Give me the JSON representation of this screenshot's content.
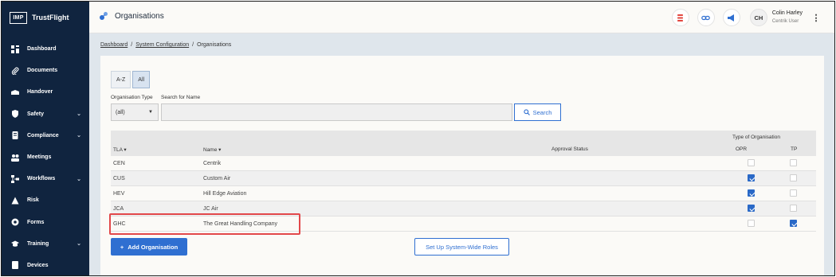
{
  "brand": {
    "logo_text": "IMP",
    "name": "TrustFlight"
  },
  "sidebar": {
    "items": [
      {
        "label": "Dashboard",
        "icon": "dashboard-icon",
        "has_chevron": false
      },
      {
        "label": "Documents",
        "icon": "paperclip-icon",
        "has_chevron": false
      },
      {
        "label": "Handover",
        "icon": "handover-icon",
        "has_chevron": false
      },
      {
        "label": "Safety",
        "icon": "shield-icon",
        "has_chevron": true
      },
      {
        "label": "Compliance",
        "icon": "compliance-icon",
        "has_chevron": true
      },
      {
        "label": "Meetings",
        "icon": "meetings-icon",
        "has_chevron": false
      },
      {
        "label": "Workflows",
        "icon": "workflows-icon",
        "has_chevron": true
      },
      {
        "label": "Risk",
        "icon": "risk-icon",
        "has_chevron": false
      },
      {
        "label": "Forms",
        "icon": "forms-icon",
        "has_chevron": false
      },
      {
        "label": "Training",
        "icon": "graduation-cap-icon",
        "has_chevron": true
      },
      {
        "label": "Devices",
        "icon": "devices-icon",
        "has_chevron": false
      }
    ],
    "chevron": "⌄"
  },
  "header": {
    "title": "Organisations",
    "user": {
      "initials": "CH",
      "name": "Colin Harley",
      "role": "Centrik User"
    }
  },
  "breadcrumb": {
    "items": [
      "Dashboard",
      "System Configuration",
      "Organisations"
    ],
    "separator": "/"
  },
  "filters": {
    "alpha_buttons": [
      "A-Z",
      "All"
    ],
    "active_alpha": "All",
    "org_type_label": "Organisation Type",
    "org_type_value": "(all)",
    "search_name_label": "Search for Name",
    "search_name_value": "",
    "search_button": "Search"
  },
  "table": {
    "group_header": "Type of Organisation",
    "columns": {
      "tla": "TLA ▾",
      "name": "Name ▾",
      "approval": "Approval Status",
      "opr": "OPR",
      "tp": "TP"
    },
    "rows": [
      {
        "tla": "CEN",
        "name": "Centrik",
        "approval": "",
        "opr": false,
        "tp": false
      },
      {
        "tla": "CUS",
        "name": "Custom Air",
        "approval": "",
        "opr": true,
        "tp": false
      },
      {
        "tla": "HEV",
        "name": "Hill Edge Aviation",
        "approval": "",
        "opr": true,
        "tp": false
      },
      {
        "tla": "JCA",
        "name": "JC Air",
        "approval": "",
        "opr": true,
        "tp": false
      },
      {
        "tla": "GHC",
        "name": "The Great Handling Company",
        "approval": "",
        "opr": false,
        "tp": true
      }
    ]
  },
  "actions": {
    "add_label": "Add Organisation",
    "add_plus": "+",
    "roles_label": "Set Up System-Wide Roles"
  },
  "colors": {
    "sidebar_bg": "#10243f",
    "accent": "#2f6fd1",
    "highlight": "#e2484a",
    "checkbox_on": "#2a69c7"
  }
}
